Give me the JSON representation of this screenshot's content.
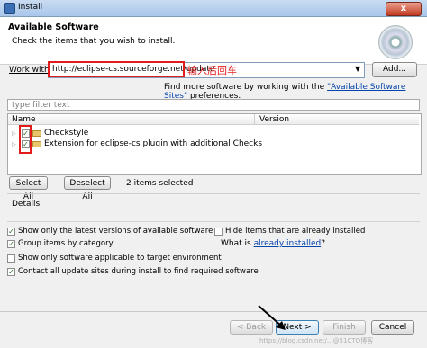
{
  "window": {
    "title": "Install",
    "close_label": "x"
  },
  "header": {
    "title": "Available Software",
    "subtitle": "Check the items that you wish to install."
  },
  "work_with": {
    "label": "Work with:",
    "value": "http://eclipse-cs.sourceforge.net/update",
    "annotation": "输入后回车",
    "add_button": "Add..."
  },
  "find_more": {
    "prefix": "Find more software by working with the ",
    "link": "\"Available Software Sites\"",
    "suffix": " preferences."
  },
  "filter": {
    "placeholder": "type filter text"
  },
  "tree": {
    "columns": {
      "name": "Name",
      "version": "Version"
    },
    "items": [
      {
        "label": "Checkstyle",
        "checked": true
      },
      {
        "label": "Extension for eclipse-cs plugin with additional Checks",
        "checked": true
      }
    ]
  },
  "selection": {
    "select_all": "Select All",
    "deselect_all": "Deselect All",
    "count": "2 items selected"
  },
  "details": {
    "label": "Details"
  },
  "options": {
    "show_latest": {
      "label": "Show only the latest versions of available software",
      "checked": true
    },
    "hide_installed": {
      "label": "Hide items that are already installed",
      "checked": false
    },
    "group_by_category": {
      "label": "Group items by category",
      "checked": true
    },
    "what_is_prefix": "What is ",
    "what_is_link": "already installed",
    "what_is_suffix": "?",
    "applicable_only": {
      "label": "Show only software applicable to target environment",
      "checked": false
    },
    "contact_sites": {
      "label": "Contact all update sites during install to find required software",
      "checked": true
    }
  },
  "footer": {
    "back": "< Back",
    "next": "Next >",
    "finish": "Finish",
    "cancel": "Cancel"
  },
  "watermark": "https://blog.csdn.net/...@51CTO博客",
  "colors": {
    "annotation_red": "#e21b1b",
    "link_blue": "#0645ad"
  }
}
